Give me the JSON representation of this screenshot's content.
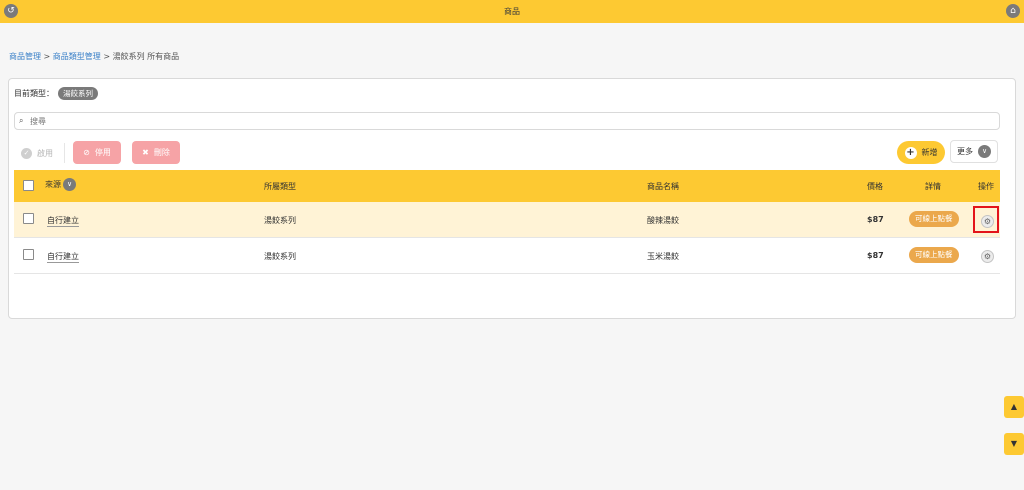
{
  "header": {
    "title": "商品",
    "back_icon": "back-icon",
    "home_icon": "home-icon"
  },
  "breadcrumb": {
    "item1": "商品管理",
    "sep1": " > ",
    "item2": "商品類型管理",
    "sep2": " > ",
    "current": "湯餃系列 所有商品"
  },
  "category": {
    "label": "目前類型：",
    "badge": "湯餃系列"
  },
  "search": {
    "placeholder": "搜尋",
    "value": ""
  },
  "toolbar": {
    "enable_label": "啟用",
    "disable_label": "停用",
    "delete_label": "刪除",
    "add_label": "新增",
    "more_label": "更多"
  },
  "table": {
    "headers": {
      "source": "來源",
      "category": "所屬類型",
      "name": "商品名稱",
      "price": "價格",
      "detail": "詳情",
      "action": "操作"
    },
    "rows": [
      {
        "source": "自行建立",
        "category": "湯餃系列",
        "name": "酸辣湯餃",
        "price": "$87",
        "detail": "可線上點餐"
      },
      {
        "source": "自行建立",
        "category": "湯餃系列",
        "name": "玉米湯餃",
        "price": "$87",
        "detail": "可線上點餐"
      }
    ]
  },
  "colors": {
    "accent": "#fdc932",
    "row_highlight": "#fff3d6",
    "danger_button": "#f6a3a6",
    "pill": "#eba84c",
    "link": "#3a80c8",
    "focus_box": "#e3141b"
  }
}
